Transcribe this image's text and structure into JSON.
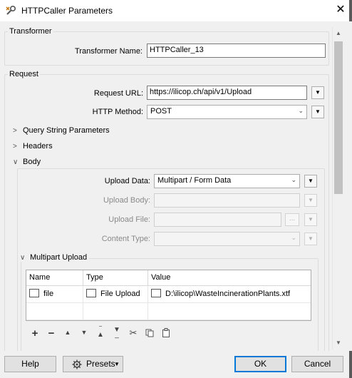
{
  "window": {
    "title": "HTTPCaller Parameters",
    "close_symbol": "✕"
  },
  "transformer": {
    "group_label": "Transformer",
    "name_label": "Transformer Name:",
    "name_value": "HTTPCaller_13"
  },
  "request": {
    "group_label": "Request",
    "url_label": "Request URL:",
    "url_value": "https://ilicop.ch/api/v1/Upload",
    "method_label": "HTTP Method:",
    "method_value": "POST",
    "sections": {
      "query": "Query String Parameters",
      "headers": "Headers",
      "body": "Body"
    },
    "body": {
      "upload_data_label": "Upload Data:",
      "upload_data_value": "Multipart / Form Data",
      "upload_body_label": "Upload Body:",
      "upload_file_label": "Upload File:",
      "content_type_label": "Content Type:",
      "ellipsis": "...",
      "multipart": {
        "group_label": "Multipart Upload",
        "columns": [
          "Name",
          "Type",
          "Value"
        ],
        "rows": [
          {
            "name": "file",
            "type": "File Upload",
            "value": "D:\\ilicop\\WasteIncinerationPlants.xtf"
          }
        ]
      }
    }
  },
  "footer": {
    "help": "Help",
    "presets": "Presets",
    "ok": "OK",
    "cancel": "Cancel"
  },
  "colors": {
    "accent": "#0078d7",
    "scroll_thumb": "#c1c1c1"
  }
}
